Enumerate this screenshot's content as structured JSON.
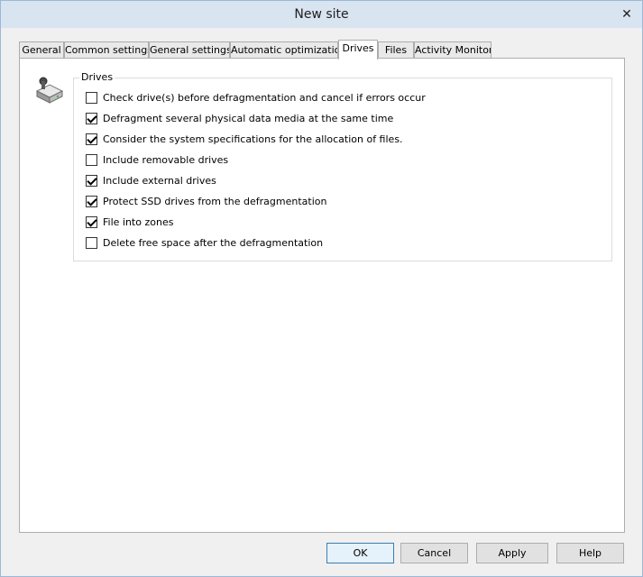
{
  "window": {
    "title": "New site",
    "close_glyph": "✕"
  },
  "tabs": [
    {
      "label": "General",
      "active": false
    },
    {
      "label": "Common settings",
      "active": false
    },
    {
      "label": "General settings",
      "active": false
    },
    {
      "label": "Automatic optimization",
      "active": false
    },
    {
      "label": "Drives",
      "active": true
    },
    {
      "label": "Files",
      "active": false
    },
    {
      "label": "Activity Monitor",
      "active": false
    }
  ],
  "drives_group": {
    "title": "Drives",
    "icon": "hard-drive-icon",
    "options": [
      {
        "label": "Check drive(s) before defragmentation and cancel if errors occur",
        "checked": false
      },
      {
        "label": "Defragment several physical data media at the same time",
        "checked": true
      },
      {
        "label": "Consider the system specifications for the allocation of files.",
        "checked": true
      },
      {
        "label": "Include removable drives",
        "checked": false
      },
      {
        "label": "Include external drives",
        "checked": true
      },
      {
        "label": "Protect SSD drives from the defragmentation",
        "checked": true
      },
      {
        "label": "File into zones",
        "checked": true
      },
      {
        "label": "Delete free space after the defragmentation",
        "checked": false
      }
    ]
  },
  "buttons": {
    "ok": "OK",
    "cancel": "Cancel",
    "apply": "Apply",
    "help": "Help"
  },
  "colors": {
    "titlebar": "#d9e4f1",
    "default_button_border": "#3c7fb1"
  }
}
